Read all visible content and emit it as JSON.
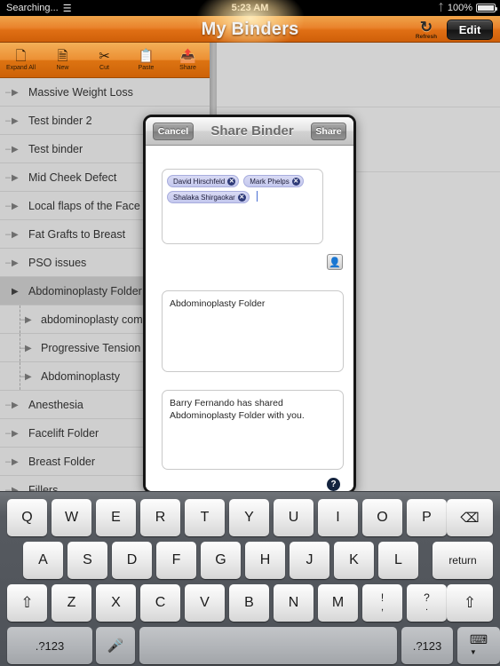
{
  "statusbar": {
    "carrier": "Searching...",
    "wifi_icon": "wifi-icon",
    "time": "5:23 AM",
    "bluetooth_icon": "bluetooth-icon",
    "battery_pct": "100%"
  },
  "navbar": {
    "title": "My Binders",
    "refresh_label": "Refresh",
    "refresh_icon": "refresh-icon",
    "edit_label": "Edit"
  },
  "toolbar": {
    "items": [
      {
        "label": "Expand All",
        "icon": "expand-all-icon",
        "glyph": "⬚"
      },
      {
        "label": "New",
        "icon": "new-icon",
        "glyph": "⬚"
      },
      {
        "label": "Cut",
        "icon": "scissors-icon",
        "glyph": "✂"
      },
      {
        "label": "Paste",
        "icon": "clipboard-icon",
        "glyph": "⬚"
      },
      {
        "label": "Share",
        "icon": "share-icon",
        "glyph": "⬚"
      }
    ]
  },
  "sidebar": {
    "rows": [
      {
        "label": "Massive Weight Loss",
        "level": 0,
        "selected": false
      },
      {
        "label": "Test binder 2",
        "level": 0,
        "selected": false
      },
      {
        "label": "Test binder",
        "level": 0,
        "selected": false
      },
      {
        "label": "Mid Cheek Defect",
        "level": 0,
        "selected": false
      },
      {
        "label": "Local flaps of the Face",
        "level": 0,
        "selected": false
      },
      {
        "label": "Fat Grafts to Breast",
        "level": 0,
        "selected": false
      },
      {
        "label": "PSO issues",
        "level": 0,
        "selected": false
      },
      {
        "label": "Abdominoplasty Folder",
        "level": 0,
        "selected": true
      },
      {
        "label": "abdominoplasty comp",
        "level": 1,
        "selected": false
      },
      {
        "label": "Progressive Tension S",
        "level": 1,
        "selected": false
      },
      {
        "label": "Abdominoplasty",
        "level": 1,
        "selected": false
      },
      {
        "label": "Anesthesia",
        "level": 0,
        "selected": false
      },
      {
        "label": "Facelift Folder",
        "level": 0,
        "selected": false
      },
      {
        "label": "Breast Folder",
        "level": 0,
        "selected": false
      },
      {
        "label": "Fillers",
        "level": 0,
        "selected": false
      }
    ]
  },
  "modal": {
    "title": "Share Binder",
    "cancel_label": "Cancel",
    "share_label": "Share",
    "recipients": [
      {
        "name": "David Hirschfeld"
      },
      {
        "name": "Mark Phelps"
      },
      {
        "name": "Shalaka Shirgaokar"
      }
    ],
    "contacts_icon": "contacts-icon",
    "subject_value": "Abdominoplasty Folder",
    "message_value": "Barry Fernando has shared Abdominoplasty Folder with you.",
    "help_label": "?"
  },
  "keyboard": {
    "row1": [
      "Q",
      "W",
      "E",
      "R",
      "T",
      "Y",
      "U",
      "I",
      "O",
      "P"
    ],
    "backspace_icon": "backspace-icon",
    "row2": [
      "A",
      "S",
      "D",
      "F",
      "G",
      "H",
      "J",
      "K",
      "L"
    ],
    "return_label": "return",
    "shift_icon": "shift-icon",
    "row3": [
      "Z",
      "X",
      "C",
      "V",
      "B",
      "N",
      "M"
    ],
    "punct1_top": "!",
    "punct1_bottom": ",",
    "punct2_top": "?",
    "punct2_bottom": ".",
    "numeric_label": ".?123",
    "mic_icon": "microphone-icon",
    "space_label": "",
    "hide_keyboard_icon": "hide-keyboard-icon"
  },
  "colors": {
    "accent_orange": "#e0780f",
    "token_blue": "#c4c8ee",
    "help_navy": "#14243f"
  }
}
